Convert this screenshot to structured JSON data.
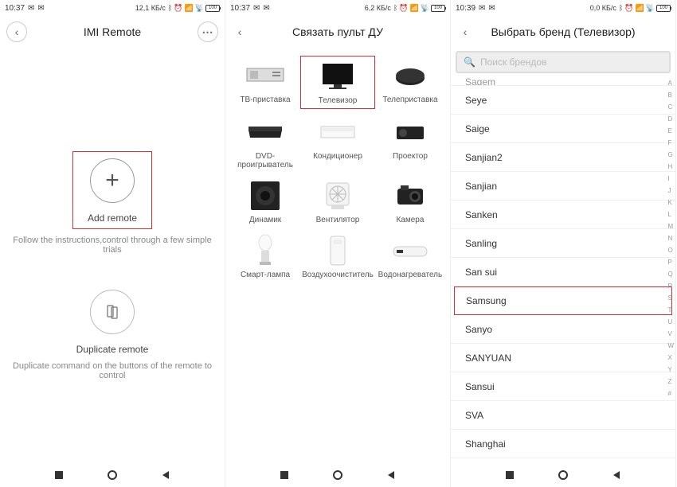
{
  "screen1": {
    "status": {
      "time": "10:37",
      "net": "12,1 КБ/с",
      "battery": "100"
    },
    "title": "IMI Remote",
    "add": {
      "label": "Add remote",
      "desc": "Follow the instructions,control through a few simple trials"
    },
    "dup": {
      "label": "Duplicate remote",
      "desc": "Duplicate command on the buttons of the remote to control"
    }
  },
  "screen2": {
    "status": {
      "time": "10:37",
      "net": "6,2 КБ/с",
      "battery": "100"
    },
    "title": "Связать пульт ДУ",
    "devices": [
      {
        "label": "ТВ-приставка"
      },
      {
        "label": "Телевизор"
      },
      {
        "label": "Телеприставка"
      },
      {
        "label": "DVD-проигрыватель"
      },
      {
        "label": "Кондиционер"
      },
      {
        "label": "Проектор"
      },
      {
        "label": "Динамик"
      },
      {
        "label": "Вентилятор"
      },
      {
        "label": "Камера"
      },
      {
        "label": "Смарт-лампа"
      },
      {
        "label": "Воздухоочиститель"
      },
      {
        "label": "Водонагреватель"
      }
    ]
  },
  "screen3": {
    "status": {
      "time": "10:39",
      "net": "0,0 КБ/с",
      "battery": "100"
    },
    "title": "Выбрать бренд (Телевизор)",
    "search_placeholder": "Поиск брендов",
    "brands_cut": "Sagem",
    "brands": [
      "Seye",
      "Saige",
      "Sanjian2",
      "Sanjian",
      "Sanken",
      "Sanling",
      "San sui",
      "Samsung",
      "Sanyo",
      "SANYUAN",
      "Sansui",
      "SVA",
      "Shanghai"
    ],
    "selected_brand": "Samsung",
    "alpha": [
      "A",
      "B",
      "C",
      "D",
      "E",
      "F",
      "G",
      "H",
      "I",
      "J",
      "K",
      "L",
      "M",
      "N",
      "O",
      "P",
      "Q",
      "R",
      "S",
      "T",
      "U",
      "V",
      "W",
      "X",
      "Y",
      "Z",
      "#"
    ]
  }
}
